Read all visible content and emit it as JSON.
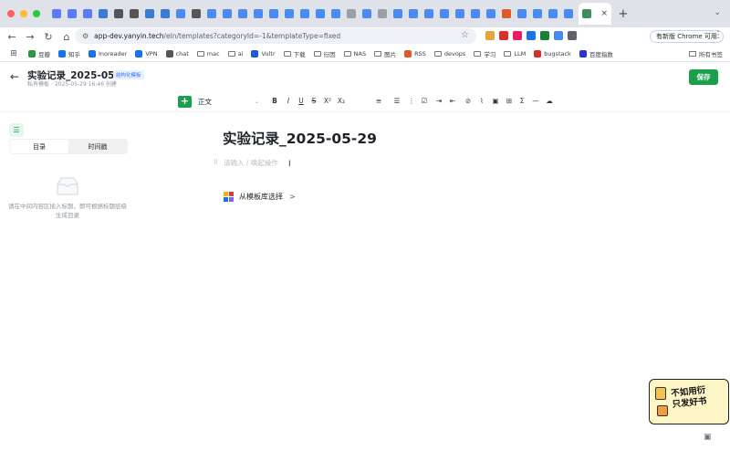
{
  "browser": {
    "traffic_colors": [
      "#ff5f57",
      "#febc2e",
      "#28c840"
    ],
    "pinned_tab_colors": [
      "#5b7cfa",
      "#5b7cfa",
      "#5b7cfa",
      "#3a7bd5",
      "#555",
      "#555",
      "#3a7bd5",
      "#3a7bd5",
      "#4a8af4",
      "#555",
      "#4a8af4",
      "#4a8af4",
      "#4a8af4",
      "#4a8af4",
      "#4a8af4",
      "#4a8af4",
      "#4a8af4",
      "#4a8af4",
      "#4a8af4",
      "#9aa0a6",
      "#4a8af4",
      "#9aa0a6",
      "#4a8af4",
      "#4a8af4",
      "#4a8af4",
      "#4a8af4",
      "#4a8af4",
      "#4a8af4",
      "#4a8af4",
      "#e05a2b",
      "#4a8af4",
      "#4a8af4",
      "#4a8af4",
      "#4a8af4"
    ],
    "active_tab_close": "×",
    "new_tab": "+",
    "tab_search_caret": "⌄",
    "nav": {
      "back": "←",
      "forward": "→",
      "reload": "↻",
      "home": "⌂"
    },
    "omnibox": {
      "tune_icon": "⚙",
      "url_host": "app-dev.yanyin.tech",
      "url_path": "/eln/templates?categoryId=-1&templateType=fixed",
      "star": "☆"
    },
    "extension_colors": [
      "#e8a33b",
      "#d93025",
      "#e91e63",
      "#1a73e8",
      "#188038",
      "#4a8af4",
      "#5f6368"
    ],
    "update_button": "有新版 Chrome 可用",
    "menu_icon": "⋮",
    "bookmarks": [
      {
        "label": "豆瓣",
        "color": "#2e963d"
      },
      {
        "label": "知乎",
        "color": "#1772f6"
      },
      {
        "label": "Inoreader",
        "color": "#1a73e8"
      },
      {
        "label": "VPN",
        "color": "#1a73e8"
      },
      {
        "label": "chat",
        "color": "#555555"
      },
      {
        "label": "mac",
        "folder": true
      },
      {
        "label": "ai",
        "folder": true
      },
      {
        "label": "Vultr",
        "color": "#1a5bd6"
      },
      {
        "label": "下载",
        "folder": true
      },
      {
        "label": "衍因",
        "folder": true
      },
      {
        "label": "NAS",
        "folder": true
      },
      {
        "label": "图片",
        "folder": true
      },
      {
        "label": "RSS",
        "color": "#e05a2b"
      },
      {
        "label": "devops",
        "folder": true
      },
      {
        "label": "学习",
        "folder": true
      },
      {
        "label": "LLM",
        "folder": true
      },
      {
        "label": "bugstack",
        "color": "#d93025"
      },
      {
        "label": "百度指数",
        "color": "#2932e1"
      }
    ],
    "all_bookmarks": "所有书签"
  },
  "header": {
    "back_icon": "←",
    "title": "实验记录_2025-05-29",
    "badge": "结构化模板",
    "meta_template": "私有模板",
    "meta_sep": "·",
    "meta_created": "2025-05-29 16:46 创建",
    "save": "保存"
  },
  "editor_toolbar": {
    "insert": "+",
    "block_style": "正文",
    "block_caret": "⌄",
    "buttons": [
      {
        "name": "bold-button",
        "glyph": "B"
      },
      {
        "name": "italic-button",
        "glyph": "I"
      },
      {
        "name": "underline-button",
        "glyph": "U"
      },
      {
        "name": "strikethrough-button",
        "glyph": "S"
      },
      {
        "name": "superscript-button",
        "glyph": "X²"
      },
      {
        "name": "subscript-button",
        "glyph": "X₂"
      },
      {
        "name": "align-button",
        "glyph": "≡"
      },
      {
        "name": "bullet-list-button",
        "glyph": "☰"
      },
      {
        "name": "ordered-list-button",
        "glyph": "⋮"
      },
      {
        "name": "todo-list-button",
        "glyph": "☑"
      },
      {
        "name": "indent-button",
        "glyph": "⇥"
      },
      {
        "name": "outdent-button",
        "glyph": "⇤"
      },
      {
        "name": "link-button",
        "glyph": "⊘"
      },
      {
        "name": "attachment-button",
        "glyph": "⌇"
      },
      {
        "name": "image-button",
        "glyph": "▣"
      },
      {
        "name": "table-button",
        "glyph": "⊞"
      },
      {
        "name": "formula-button",
        "glyph": "Σ"
      },
      {
        "name": "divider-button",
        "glyph": "—"
      },
      {
        "name": "more-button",
        "glyph": "☁"
      }
    ]
  },
  "sidebar": {
    "toc_icon": "☰",
    "tabs": [
      "目录",
      "时间戳"
    ],
    "empty_text": "请在中间内容区插入标题，即可根据标题层级生成目录"
  },
  "editor": {
    "title": "实验记录_2025-05-29",
    "drag_handle": "⠿",
    "placeholder": "请输入 / 唤起操作",
    "cursor": "I",
    "template_link": "从模板库选择",
    "template_chevron": ">"
  },
  "floating": {
    "sticker_line1": "不如用衍",
    "sticker_line2": "只发好书",
    "feedback_icon": "▣"
  }
}
